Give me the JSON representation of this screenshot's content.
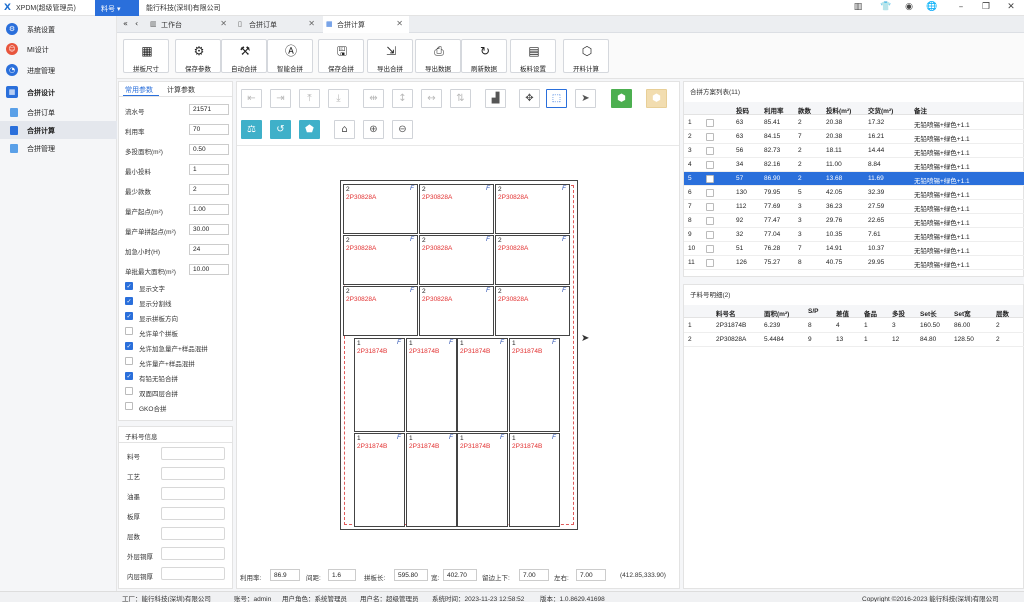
{
  "titlebar": {
    "logo": "X",
    "app_title": "XPDM(超级管理员)",
    "module_tab": "料号",
    "company": "能行科技(深圳)有限公司",
    "icons": [
      "bar-chart-icon",
      "shirt-icon",
      "user-circle-icon",
      "globe-icon",
      "minimize-icon",
      "restore-icon",
      "close-icon"
    ]
  },
  "sidebar": {
    "items": [
      {
        "label": "系统设置",
        "icon": "gear-icon",
        "color": "#2a6fdb"
      },
      {
        "label": "MI设计",
        "icon": "users-icon",
        "color": "#e8553d"
      },
      {
        "label": "进度管理",
        "icon": "progress-icon",
        "color": "#2a6fdb"
      },
      {
        "label": "合拼设计",
        "icon": "grid-icon",
        "color": "#2a6fdb"
      }
    ],
    "subitems": [
      {
        "label": "合拼订单"
      },
      {
        "label": "合拼计算"
      },
      {
        "label": "合拼管理"
      }
    ]
  },
  "tabs": {
    "back": "«",
    "prev": "‹",
    "items": [
      {
        "label": "工作台",
        "icon": "chart-icon"
      },
      {
        "label": "合拼订单",
        "icon": "doc-icon"
      },
      {
        "label": "合拼计算",
        "icon": "grid-icon"
      }
    ]
  },
  "toolbar": {
    "buttons": [
      {
        "label": "拼板尺寸",
        "icon": "▦"
      },
      {
        "label": "保存参数",
        "icon": "⚙"
      },
      {
        "label": "自动合拼",
        "icon": "⚒"
      },
      {
        "label": "智能合拼",
        "icon": "Ⓐ"
      },
      {
        "label": "保存合拼",
        "icon": "🖫"
      },
      {
        "label": "导出合拼",
        "icon": "⇲"
      },
      {
        "label": "导出数据",
        "icon": "⎙"
      },
      {
        "label": "刷新数据",
        "icon": "↻"
      },
      {
        "label": "板料设置",
        "icon": "▤"
      },
      {
        "label": "开料计算",
        "icon": "⬡"
      }
    ]
  },
  "params": {
    "tabs": [
      "常用参数",
      "计算参数"
    ],
    "fields": [
      {
        "label": "流水号",
        "value": "21571"
      },
      {
        "label": "利用率",
        "value": "70"
      },
      {
        "label": "多投面积(m²)",
        "value": "0.50"
      },
      {
        "label": "最小投料",
        "value": "1"
      },
      {
        "label": "最少款数",
        "value": "2"
      },
      {
        "label": "量产起点(m²)",
        "value": "1.00"
      },
      {
        "label": "量产单拼起点(m²)",
        "value": "30.00"
      },
      {
        "label": "加急小时(H)",
        "value": "24"
      },
      {
        "label": "单批最大面积(m²)",
        "value": "10.00"
      }
    ],
    "checks": [
      {
        "label": "显示文字",
        "checked": true
      },
      {
        "label": "显示分割线",
        "checked": true
      },
      {
        "label": "显示拼板方向",
        "checked": true
      },
      {
        "label": "允许单个拼板",
        "checked": false
      },
      {
        "label": "允许加急量产+样品混拼",
        "checked": true
      },
      {
        "label": "允许量产+样品混拼",
        "checked": false
      },
      {
        "label": "有铅无铅合拼",
        "checked": true
      },
      {
        "label": "双面四层合拼",
        "checked": false
      },
      {
        "label": "GKO合拼",
        "checked": false
      }
    ]
  },
  "info": {
    "title": "子料号信息",
    "rows": [
      "料号",
      "工艺",
      "油墨",
      "板厚",
      "层数",
      "外层铜厚",
      "内层铜厚"
    ]
  },
  "canvas": {
    "tools_row1": [
      "⇤",
      "⇥",
      "⤒",
      "⤓",
      "⇹",
      "↕",
      "↔",
      "⇅",
      "▟",
      "✥",
      "⬚",
      "➤",
      "⬢",
      "⬢"
    ],
    "tools_row2": [
      "⚖",
      "↺",
      "⬟",
      "⌂",
      "⊕",
      "⊖"
    ],
    "cells_a": {
      "num": "2",
      "label": "2P30828A",
      "flag": "F"
    },
    "cells_b": {
      "num": "1",
      "label": "2P31874B",
      "flag": "F"
    },
    "status": {
      "usage_label": "利用率:",
      "usage": "86.9",
      "gap_label": "间距:",
      "gap": "1.6",
      "length_label": "拼板长:",
      "length": "595.80",
      "width_label": "宽:",
      "width": "402.70",
      "tb_label": "留边上下:",
      "tb": "7.00",
      "lr_label": "左右:",
      "lr": "7.00",
      "coords": "(412.85,333.90)"
    }
  },
  "plans": {
    "title": "合拼方案列表(11)",
    "headers": [
      "",
      "",
      "投码",
      "利用率",
      "款数",
      "投料(m²)",
      "交货(m²)",
      "备注"
    ],
    "rows": [
      [
        "1",
        "",
        "63",
        "85.41",
        "2",
        "20.38",
        "17.32",
        "无铅喷锡+绿色+1.1"
      ],
      [
        "2",
        "",
        "63",
        "84.15",
        "7",
        "20.38",
        "16.21",
        "无铅喷锡+绿色+1.1"
      ],
      [
        "3",
        "",
        "56",
        "82.73",
        "2",
        "18.11",
        "14.44",
        "无铅喷锡+绿色+1.1"
      ],
      [
        "4",
        "",
        "34",
        "82.16",
        "2",
        "11.00",
        "8.84",
        "无铅喷锡+绿色+1.1"
      ],
      [
        "5",
        "",
        "57",
        "86.90",
        "2",
        "13.68",
        "11.69",
        "无铅喷锡+绿色+1.1"
      ],
      [
        "6",
        "",
        "130",
        "79.95",
        "5",
        "42.05",
        "32.39",
        "无铅喷锡+绿色+1.1"
      ],
      [
        "7",
        "",
        "112",
        "77.69",
        "3",
        "36.23",
        "27.59",
        "无铅喷锡+绿色+1.1"
      ],
      [
        "8",
        "",
        "92",
        "77.47",
        "3",
        "29.76",
        "22.65",
        "无铅喷锡+绿色+1.1"
      ],
      [
        "9",
        "",
        "32",
        "77.04",
        "3",
        "10.35",
        "7.61",
        "无铅喷锡+绿色+1.1"
      ],
      [
        "10",
        "",
        "51",
        "76.28",
        "7",
        "14.91",
        "10.37",
        "无铅喷锡+绿色+1.1"
      ],
      [
        "11",
        "",
        "126",
        "75.27",
        "8",
        "40.75",
        "29.95",
        "无铅喷锡+绿色+1.1"
      ]
    ],
    "selected_index": 4
  },
  "parts": {
    "title": "子料号明细(2)",
    "headers": [
      "",
      "料号名",
      "面积(m²)",
      "S/P",
      "差值",
      "备品",
      "多投",
      "Set长",
      "Set宽",
      "层数"
    ],
    "rows": [
      [
        "1",
        "2P31874B",
        "6.239",
        "8",
        "4",
        "1",
        "3",
        "160.50",
        "86.00",
        "2"
      ],
      [
        "2",
        "2P30828A",
        "5.4484",
        "9",
        "13",
        "1",
        "12",
        "84.80",
        "128.50",
        "2"
      ]
    ]
  },
  "footer": {
    "factory_label": "工厂：能行科技(深圳)有限公司",
    "account_label": "账号：admin",
    "role_label": "用户角色：系统管理员",
    "username_label": "用户名：超级管理员",
    "systime_label": "系统时间：2023-11-23 12:58:52",
    "version_label": "版本：1.0.8629.41698",
    "copyright": "Copyright ©2016-2023 能行科技(深圳)有限公司"
  },
  "colors": {
    "accent": "#2a6fdb",
    "cell_label": "#e23030",
    "teal": "#3fb0c9",
    "green": "#4caf50"
  }
}
